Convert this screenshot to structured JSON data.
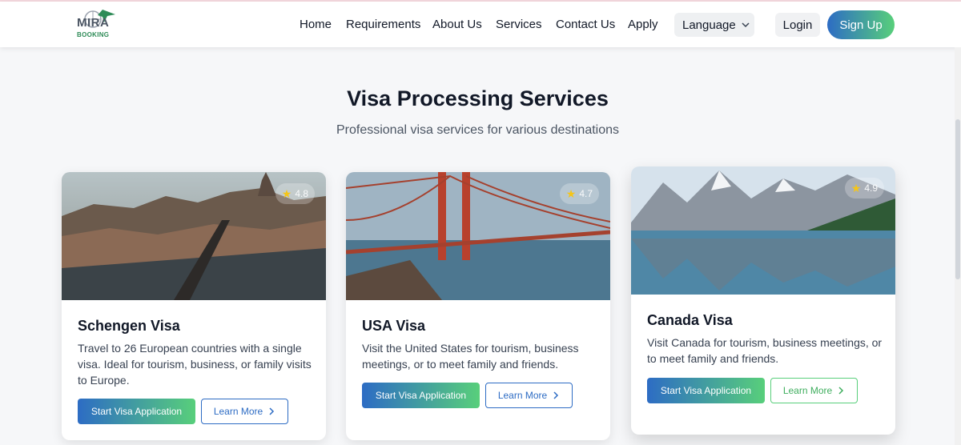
{
  "brand": {
    "name": "MIRA",
    "sub": "BOOKING"
  },
  "nav": {
    "links": [
      "Home",
      "Requirements",
      "About Us",
      "Services",
      "Contact Us",
      "Apply"
    ],
    "language_label": "Language",
    "login_label": "Login",
    "signup_label": "Sign Up"
  },
  "section": {
    "title": "Visa Processing Services",
    "subtitle": "Professional visa services for various destinations"
  },
  "cards": [
    {
      "title": "Schengen Visa",
      "rating": "4.8",
      "description": "Travel to 26 European countries with a single visa. Ideal for tourism, business, or family visits to Europe.",
      "primary_label": "Start Visa Application",
      "secondary_label": "Learn More"
    },
    {
      "title": "USA Visa",
      "rating": "4.7",
      "description": "Visit the United States for tourism, business meetings, or to meet family and friends.",
      "primary_label": "Start Visa Application",
      "secondary_label": "Learn More"
    },
    {
      "title": "Canada Visa",
      "rating": "4.9",
      "description": "Visit Canada for tourism, business meetings, or to meet family and friends.",
      "primary_label": "Start Visa Application",
      "secondary_label": "Learn More"
    }
  ],
  "colors": {
    "accent_blue": "#2d6cc4",
    "accent_green": "#58cf7b"
  },
  "icons": {
    "rating": "star-icon",
    "language": "chevron-down-icon",
    "learn_more": "chevron-right-icon"
  }
}
